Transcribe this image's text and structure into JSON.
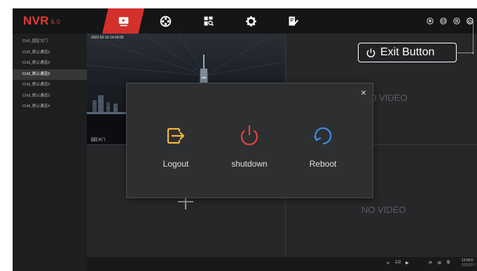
{
  "app": {
    "logo": "NVR",
    "version": "6.0"
  },
  "tabs": [
    {
      "icon": "live-view-icon",
      "active": true
    },
    {
      "icon": "playback-icon",
      "active": false
    },
    {
      "icon": "file-search-icon",
      "active": false
    },
    {
      "icon": "settings-icon",
      "active": false
    },
    {
      "icon": "edit-icon",
      "active": false
    }
  ],
  "system_buttons": [
    "alarm-icon",
    "device-icon",
    "layout-icon",
    "power-icon"
  ],
  "channels": [
    "CH1_园区大门",
    "CH2_默认通道2",
    "CH3_默认通道3",
    "CH3_默认通道3",
    "CH3_默认通道3",
    "CH3_默认通道3",
    "CH4_默认通道4"
  ],
  "active_channel_index": 3,
  "camera": {
    "timestamp": "2022-02-10 14:00:00",
    "name": "园区大门"
  },
  "no_video_text": "NO VIDEO",
  "dialog": {
    "close": "×",
    "actions": [
      {
        "label": "Logout",
        "icon": "logout-icon",
        "color": "#f3b737"
      },
      {
        "label": "shutdown",
        "icon": "power-icon",
        "color": "#e2433f"
      },
      {
        "label": "Reboot",
        "icon": "reboot-icon",
        "color": "#3b8de6"
      }
    ]
  },
  "bottom_bar": {
    "page": "1/2",
    "time": "13:00:0",
    "date": "2022/07/"
  },
  "callout": {
    "label": "Exit Button"
  },
  "colors": {
    "accent": "#d3302c",
    "logo": "#e63a35"
  }
}
